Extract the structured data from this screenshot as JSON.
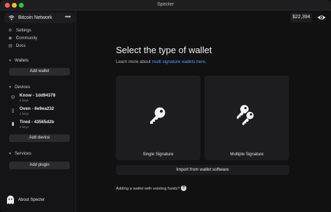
{
  "window": {
    "title": "Specter"
  },
  "sidebar": {
    "network_label": "Bitcoin Network",
    "nav": [
      {
        "label": "Settings",
        "icon": "gear-icon"
      },
      {
        "label": "Community",
        "icon": "community-icon"
      },
      {
        "label": "Docs",
        "icon": "docs-icon"
      }
    ],
    "sections": {
      "wallets": {
        "label": "Wallets",
        "button": "Add wallet"
      },
      "devices": {
        "label": "Devices",
        "button": "Add device"
      },
      "services": {
        "label": "Services",
        "button": "Add plugin"
      }
    },
    "devices": [
      {
        "name": "Know - 1dd94378",
        "keys": "4 keys",
        "icon": "device-icon"
      },
      {
        "name": "Oven - 6e9ea232",
        "keys": "4 keys",
        "icon": "device-icon"
      },
      {
        "name": "Tired - 43565d2b",
        "keys": "4 keys",
        "icon": "device-icon"
      }
    ],
    "about_label": "About Specter"
  },
  "header": {
    "balance": "$22,394"
  },
  "main": {
    "title": "Select the type of wallet",
    "subtitle_prefix": "Learn more about ",
    "subtitle_link": "multi signature wallets here",
    "subtitle_suffix": ".",
    "options": [
      {
        "label": "Single Signature",
        "icon": "single-key-icon"
      },
      {
        "label": "Multiple Signature",
        "icon": "multiple-keys-icon"
      }
    ],
    "import_label": "Import from wallet software",
    "existing_funds_text": "Adding a wallet with existing funds?",
    "help_glyph": "?"
  },
  "colors": {
    "link": "#5b9cff",
    "background": "#111112",
    "card": "#1d1d20"
  }
}
